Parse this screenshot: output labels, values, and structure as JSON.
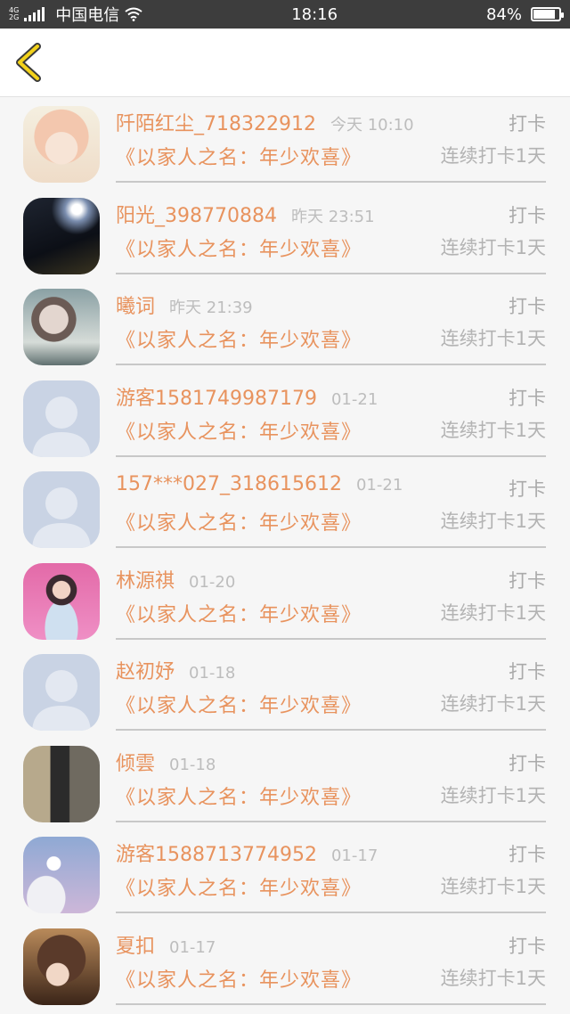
{
  "status": {
    "net_top": "4G",
    "net_bottom": "2G",
    "carrier": "中国电信",
    "time": "18:16",
    "battery": "84%",
    "battery_level": 0.84
  },
  "records": [
    {
      "name": "阡陌红尘_718322912",
      "time": "今天 10:10",
      "status": "打卡",
      "book": "《以家人之名：年少欢喜》",
      "streak": "连续打卡1天"
    },
    {
      "name": "阳光_398770884",
      "time": "昨天 23:51",
      "status": "打卡",
      "book": "《以家人之名：年少欢喜》",
      "streak": "连续打卡1天"
    },
    {
      "name": "曦词",
      "time": "昨天 21:39",
      "status": "打卡",
      "book": "《以家人之名：年少欢喜》",
      "streak": "连续打卡1天"
    },
    {
      "name": "游客1581749987179",
      "time": "01-21",
      "status": "打卡",
      "book": "《以家人之名：年少欢喜》",
      "streak": "连续打卡1天"
    },
    {
      "name": "157***027_318615612",
      "time": "01-21",
      "status": "打卡",
      "book": "《以家人之名：年少欢喜》",
      "streak": "连续打卡1天"
    },
    {
      "name": "林源祺",
      "time": "01-20",
      "status": "打卡",
      "book": "《以家人之名：年少欢喜》",
      "streak": "连续打卡1天"
    },
    {
      "name": "赵初妤",
      "time": "01-18",
      "status": "打卡",
      "book": "《以家人之名：年少欢喜》",
      "streak": "连续打卡1天"
    },
    {
      "name": "倾雲",
      "time": "01-18",
      "status": "打卡",
      "book": "《以家人之名：年少欢喜》",
      "streak": "连续打卡1天"
    },
    {
      "name": "游客1588713774952",
      "time": "01-17",
      "status": "打卡",
      "book": "《以家人之名：年少欢喜》",
      "streak": "连续打卡1天"
    },
    {
      "name": "夏扣",
      "time": "01-17",
      "status": "打卡",
      "book": "《以家人之名：年少欢喜》",
      "streak": "连续打卡1天"
    }
  ]
}
